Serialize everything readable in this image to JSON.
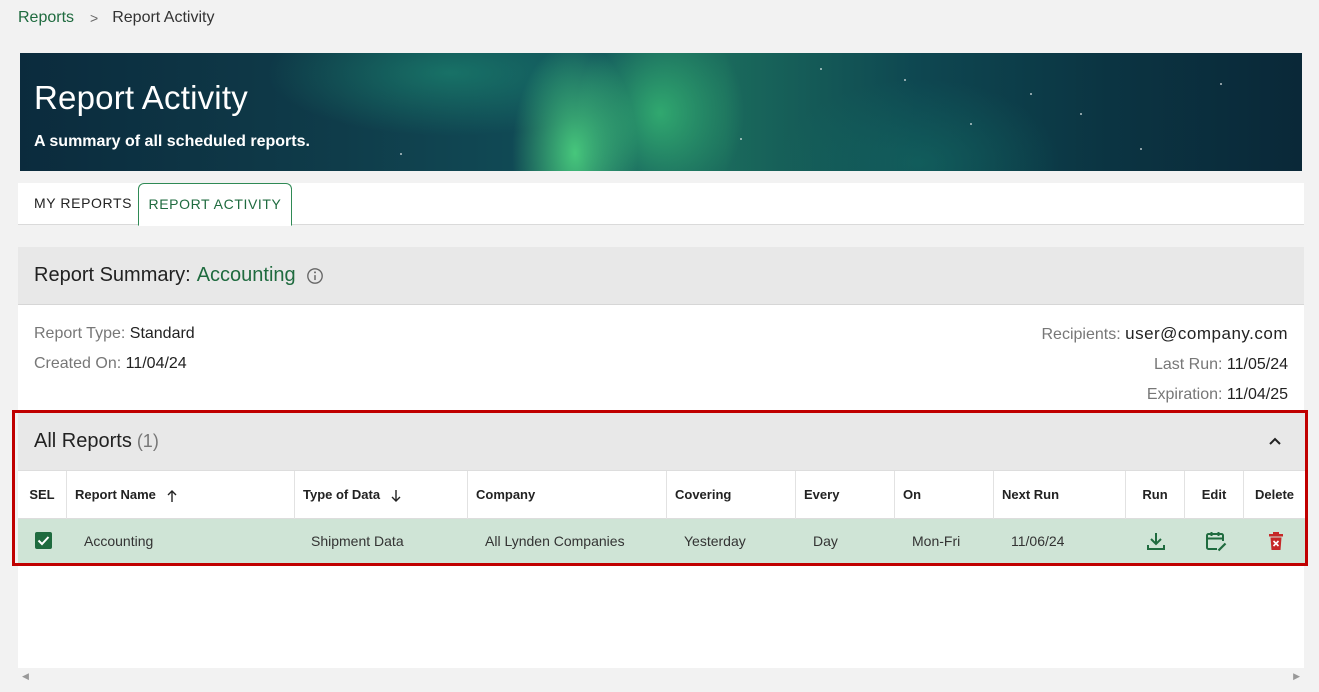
{
  "breadcrumb": {
    "parent": "Reports",
    "separator": ">",
    "current": "Report Activity"
  },
  "banner": {
    "title": "Report Activity",
    "subtitle": "A summary of all scheduled reports."
  },
  "tabs": [
    {
      "label": "MY REPORTS",
      "active": false
    },
    {
      "label": "REPORT ACTIVITY",
      "active": true
    }
  ],
  "summary": {
    "label": "Report Summary:",
    "name": "Accounting",
    "report_type_key": "Report Type:",
    "report_type_value": "Standard",
    "created_on_key": "Created On:",
    "created_on_value": "11/04/24",
    "recipients_key": "Recipients:",
    "recipients_value": "user@company.com",
    "last_run_key": "Last Run:",
    "last_run_value": "11/05/24",
    "expiration_key": "Expiration:",
    "expiration_value": "11/04/25"
  },
  "all_reports": {
    "title": "All Reports",
    "count": "(1)",
    "columns": {
      "sel": "SEL",
      "report_name": "Report Name",
      "type_of_data": "Type of Data",
      "company": "Company",
      "covering": "Covering",
      "every": "Every",
      "on": "On",
      "next_run": "Next Run",
      "run": "Run",
      "edit": "Edit",
      "delete": "Delete"
    },
    "rows": [
      {
        "selected": true,
        "report_name": "Accounting",
        "type_of_data": "Shipment Data",
        "company": "All Lynden Companies",
        "covering": "Yesterday",
        "every": "Day",
        "on": "Mon-Fri",
        "next_run": "11/06/24"
      }
    ]
  },
  "colors": {
    "accent_green": "#1f6b3f",
    "selected_row": "#cfe4d6",
    "highlight_border": "#c00000",
    "delete_red": "#c62828"
  },
  "icons": {
    "info": "info-icon",
    "collapse": "chevron-up-icon",
    "sort_asc": "arrow-up-icon",
    "sort_desc": "arrow-down-icon",
    "run": "download-icon",
    "edit": "calendar-edit-icon",
    "delete": "trash-icon",
    "checkbox": "checkbox-checked-icon"
  }
}
